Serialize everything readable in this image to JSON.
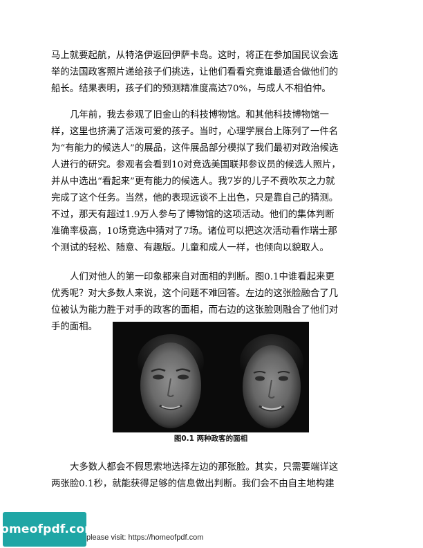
{
  "paragraphs": [
    {
      "lines": [
        "马上就要起航，从特洛伊返回伊萨卡岛。这时，将正在参加国民议会选",
        "举的法国政客照片递给孩子们挑选，让他们看看究竟谁最适合做他们的",
        "船长。结果表明，孩子们的预测精准度高达70%，与成人不相伯仲。"
      ]
    },
    {
      "lines": [
        "几年前，我去参观了旧金山的科技博物馆。和其他科技博物馆一",
        "样，这里也挤满了活泼可爱的孩子。当时，心理学展台上陈列了一件名",
        "为“有能力的候选人”的展品，这件展品部分模拟了我们最初对政治候选",
        "人进行的研究。参观者会看到10对竞选美国联邦参议员的候选人照片，",
        "并从中选出“看起来”更有能力的候选人。我7岁的儿子不费吹灰之力就",
        "完成了这个任务。当然，他的表现远谈不上出色，只是靠自己的猜测。",
        "不过，那天有超过1.9万人参与了博物馆的这项活动。他们的集体判断",
        "准确率极高，10场竞选中猜对了7场。诸位可以把这次活动看作瑞士那",
        "个测试的轻松、随意、有趣版。儿童和成人一样，也倾向以貌取人。"
      ]
    },
    {
      "lines": [
        "人们对他人的第一印象都来自对面相的判断。图0.1中谁看起来更",
        "优秀呢？对大多数人来说，这个问题不难回答。左边的这张脸融合了几",
        "位被认为能力胜于对手的政客的面相，而右边的这张脸则融合了他们对",
        "手的面相。"
      ]
    },
    {
      "lines": [
        "大多数人都会不假思索地选择左边的那张脸。其实，只需要端详这",
        "两张脸0.1秒，就能获得足够的信息做出判断。我们会不由自主地构建"
      ]
    }
  ],
  "figure": {
    "caption": "图0.1 两种政客的面相",
    "background_color": "#0b0b0b"
  },
  "footer": {
    "badge_text": "homeofpdf.com",
    "badge_color": "#1fa6a5",
    "visit_text": "please visit: https://homeofpdf.com"
  }
}
